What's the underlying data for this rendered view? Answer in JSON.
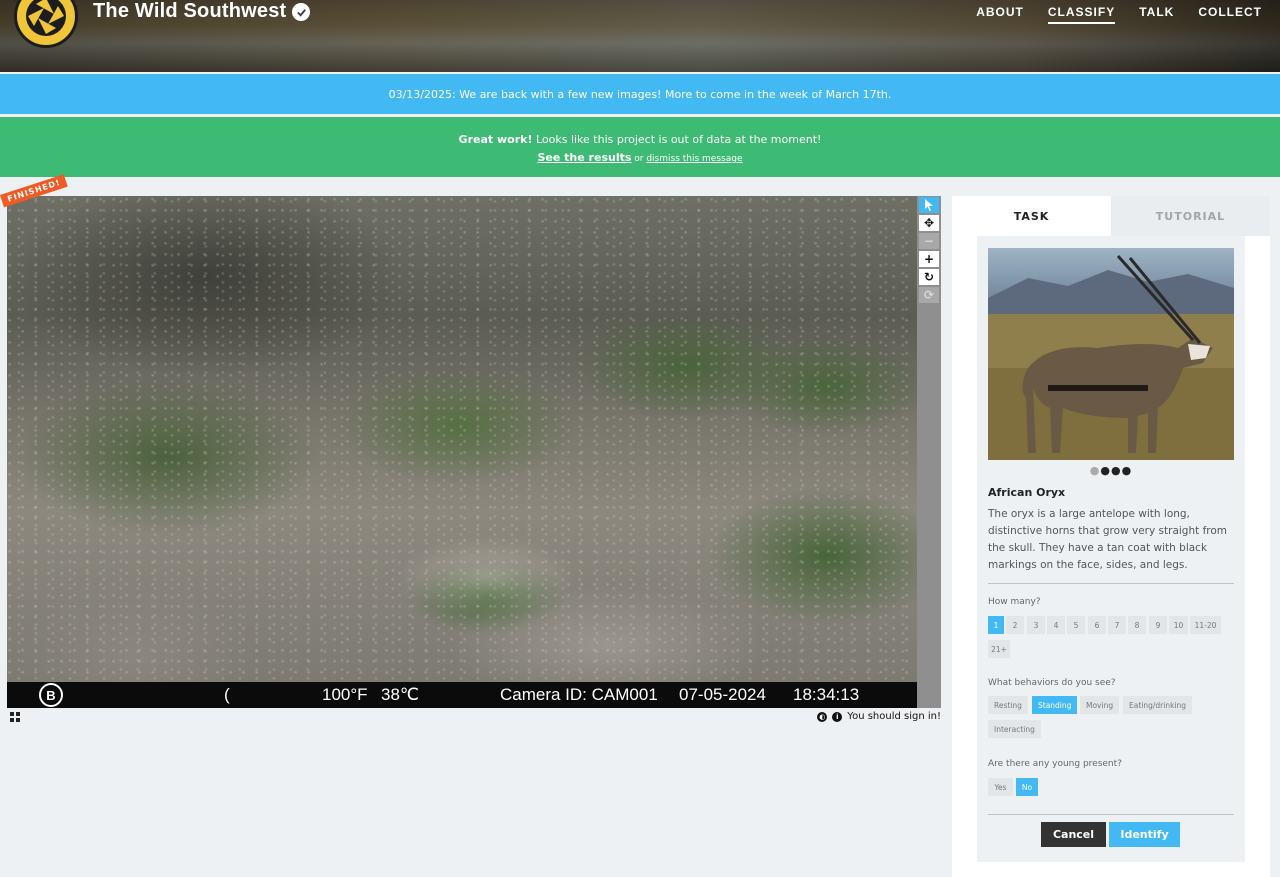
{
  "header": {
    "site_title": "The Wild Southwest",
    "nav": [
      "ABOUT",
      "CLASSIFY",
      "TALK",
      "COLLECT"
    ],
    "active_nav": "CLASSIFY"
  },
  "announcement": {
    "text": "03/13/2025: We are back with a few new images! More to come in the week of March 17th."
  },
  "finished_banner": {
    "bold": "Great work!",
    "text": " Looks like this project is out of data at the moment!",
    "results_link": "See the results",
    "or": " or ",
    "dismiss_link": "dismiss this message"
  },
  "viewer": {
    "finished_tag": "FINISHED!",
    "camera_strip": {
      "logo": "B",
      "moon": "(",
      "temp_f": "100°F",
      "temp_c": "38℃",
      "camera_id": "Camera ID: CAM001",
      "date": "07-05-2024",
      "time": "18:34:13"
    },
    "sign_in_text": "You should sign in!"
  },
  "toolbar": {
    "tools": [
      "pointer-icon",
      "move-icon",
      "zoom-out-icon",
      "zoom-in-icon",
      "rotate-icon",
      "reset-icon"
    ]
  },
  "panel": {
    "tabs": [
      "TASK",
      "TUTORIAL"
    ],
    "active_tab": "TASK",
    "animal": {
      "name": "African Oryx",
      "description": "The oryx is a large antelope with long, distinctive horns that grow very straight from the skull. They have a tan coat with black markings on the face, sides, and legs.",
      "image_index": 1,
      "image_count": 4
    },
    "how_many": {
      "label": "How many?",
      "options": [
        "1",
        "2",
        "3",
        "4",
        "5",
        "6",
        "7",
        "8",
        "9",
        "10",
        "11-20",
        "21+"
      ],
      "selected": "1"
    },
    "behaviors": {
      "label": "What behaviors do you see?",
      "options": [
        "Resting",
        "Standing",
        "Moving",
        "Eating/drinking",
        "Interacting"
      ],
      "selected": [
        "Standing"
      ]
    },
    "young": {
      "label": "Are there any young present?",
      "options": [
        "Yes",
        "No"
      ],
      "selected": "No"
    },
    "buttons": {
      "cancel": "Cancel",
      "identify": "Identify"
    }
  },
  "colors": {
    "accent_blue": "#43b9f4",
    "success_green": "#3dba73",
    "finished_orange": "#f05a24"
  }
}
